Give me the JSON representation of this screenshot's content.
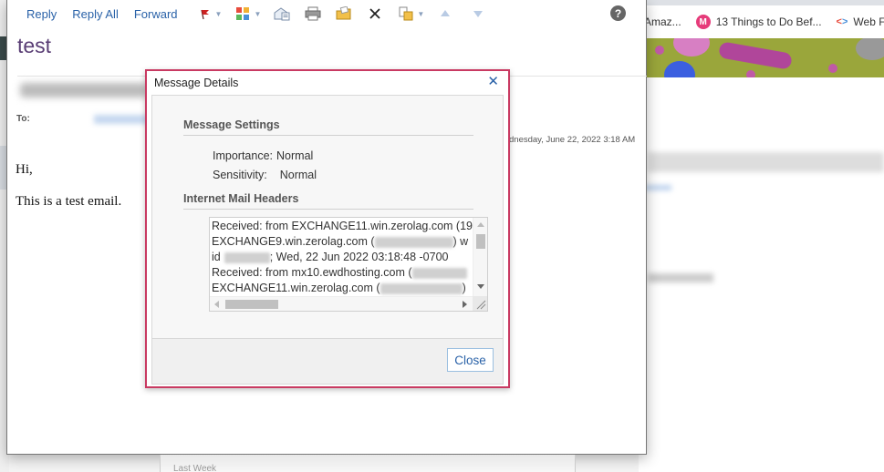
{
  "toolbar": {
    "reply": "Reply",
    "reply_all": "Reply All",
    "forward": "Forward",
    "icons": [
      "flag-icon",
      "categories-icon",
      "open-envelope-icon",
      "print-icon",
      "move-to-folder-icon",
      "delete-icon",
      "copy-icon",
      "previous-item-icon",
      "next-item-icon",
      "help-icon"
    ],
    "help": "?"
  },
  "message": {
    "subject": "test",
    "to_label": "To:",
    "date": "dnesday, June 22, 2022 3:18 AM",
    "body_lines": [
      "Hi,",
      "This is a test email."
    ]
  },
  "dialog": {
    "title": "Message Details",
    "close_x": "✕",
    "message_settings_title": "Message Settings",
    "importance_label": "Importance:",
    "importance_value": "Normal",
    "sensitivity_label": "Sensitivity:",
    "sensitivity_value": "Normal",
    "headers_title": "Internet Mail Headers",
    "header_lines": [
      "Received: from EXCHANGE11.win.zerolag.com (19",
      " EXCHANGE9.win.zerolag.com (",
      ") w",
      " id",
      "; Wed, 22 Jun 2022 03:18:48 -0700",
      "Received: from mx10.ewdhosting.com (",
      " EXCHANGE11.win.zerolag.com (",
      ")"
    ],
    "close_button": "Close"
  },
  "browser": {
    "bookmarks": [
      {
        "label": "Amaz..."
      },
      {
        "label": "13 Things to Do Bef...",
        "icon": "M"
      },
      {
        "label": "Web F"
      }
    ]
  },
  "bottom": {
    "text": "Last Week"
  },
  "colors": {
    "accent_link": "#2a62a8",
    "subject": "#5a3e75",
    "dialog_border": "#c93a62"
  }
}
